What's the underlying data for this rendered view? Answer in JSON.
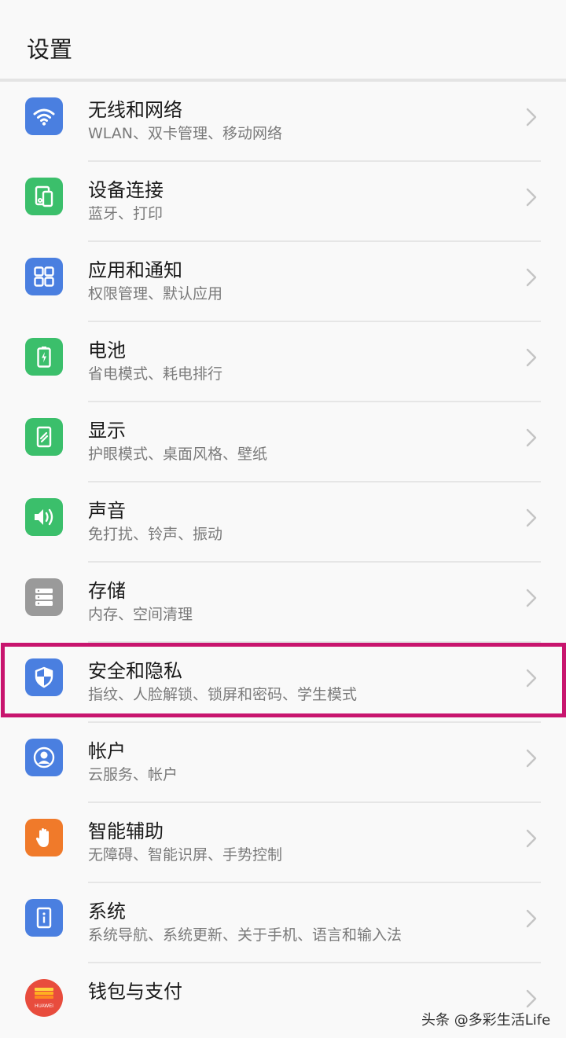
{
  "header": {
    "title": "设置"
  },
  "settings": [
    {
      "title": "无线和网络",
      "subtitle": "WLAN、双卡管理、移动网络",
      "icon": "wifi-icon",
      "color": "#4a7fe0"
    },
    {
      "title": "设备连接",
      "subtitle": "蓝牙、打印",
      "icon": "device-connect-icon",
      "color": "#3bbf6b"
    },
    {
      "title": "应用和通知",
      "subtitle": "权限管理、默认应用",
      "icon": "apps-grid-icon",
      "color": "#4a7fe0"
    },
    {
      "title": "电池",
      "subtitle": "省电模式、耗电排行",
      "icon": "battery-icon",
      "color": "#3bbf6b"
    },
    {
      "title": "显示",
      "subtitle": "护眼模式、桌面风格、壁纸",
      "icon": "display-icon",
      "color": "#3bbf6b"
    },
    {
      "title": "声音",
      "subtitle": "免打扰、铃声、振动",
      "icon": "speaker-icon",
      "color": "#3bbf6b"
    },
    {
      "title": "存储",
      "subtitle": "内存、空间清理",
      "icon": "storage-icon",
      "color": "#9a9a9a"
    },
    {
      "title": "安全和隐私",
      "subtitle": "指纹、人脸解锁、锁屏和密码、学生模式",
      "icon": "shield-icon",
      "color": "#4a7fe0"
    },
    {
      "title": "帐户",
      "subtitle": "云服务、帐户",
      "icon": "account-icon",
      "color": "#4a7fe0"
    },
    {
      "title": "智能辅助",
      "subtitle": "无障碍、智能识屏、手势控制",
      "icon": "hand-icon",
      "color": "#f07a2a"
    },
    {
      "title": "系统",
      "subtitle": "系统导航、系统更新、关于手机、语言和输入法",
      "icon": "system-info-icon",
      "color": "#4a7fe0"
    },
    {
      "title": "钱包与支付",
      "subtitle": "",
      "icon": "huawei-wallet-icon",
      "color": "#e84c3d",
      "icon_text": "HUAWEI"
    }
  ],
  "highlight_color": "#c8156e",
  "watermark": "头条 @多彩生活Life"
}
